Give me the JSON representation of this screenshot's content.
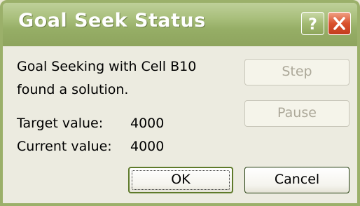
{
  "window": {
    "title": "Goal Seek Status"
  },
  "titlebar_buttons": {
    "help_glyph": "?",
    "help_icon": "question-mark-icon",
    "close_icon": "close-x-icon"
  },
  "status": {
    "line1": "Goal Seeking with Cell B10",
    "line2": "found a solution."
  },
  "values": {
    "target_label": "Target value:",
    "target_value": "4000",
    "current_label": "Current value:",
    "current_value": "4000"
  },
  "buttons": {
    "step_label": "Step",
    "pause_label": "Pause",
    "ok_label": "OK",
    "cancel_label": "Cancel"
  },
  "colors": {
    "titlebar": "#a3ba73",
    "window_body": "#ecebe0",
    "close_button": "#d9512d"
  }
}
